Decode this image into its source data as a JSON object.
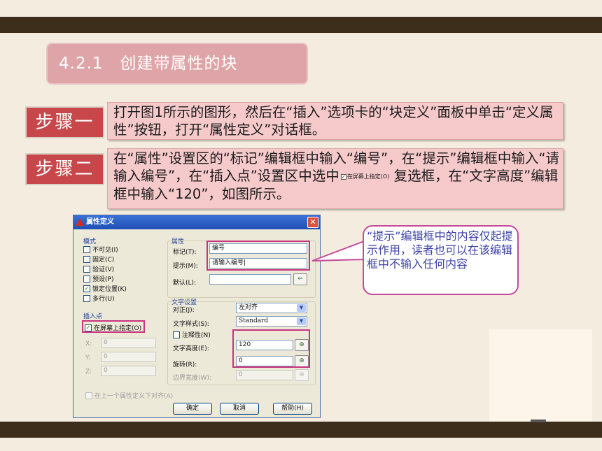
{
  "section_title": "4.2.1　创建带属性的块",
  "steps": [
    {
      "tag": "步骤一",
      "text": "打开图1所示的图形，然后在“插入”选项卡的“块定义”面板中单击“定义属性”按钮，打开“属性定义”对话框。"
    },
    {
      "tag": "步骤二",
      "text_before": "在“属性”设置区的“标记”编辑框中输入“编号”，在“提示”编辑框中输入“请输入编号”，在“插入点”设置区中选中",
      "inline_checkbox": "在屏幕上指定(O)",
      "text_after": "复选框，在“文字高度”编辑框中输入“120”，如图所示。"
    }
  ],
  "dialog": {
    "title": "属性定义",
    "close": "✕",
    "mode": {
      "label": "模式",
      "items": [
        {
          "label": "不可见(I)",
          "checked": false
        },
        {
          "label": "固定(C)",
          "checked": false
        },
        {
          "label": "验证(V)",
          "checked": false
        },
        {
          "label": "预设(P)",
          "checked": false
        },
        {
          "label": "锁定位置(K)",
          "checked": true
        },
        {
          "label": "多行(U)",
          "checked": false
        }
      ]
    },
    "insert_point": {
      "label": "插入点",
      "on_screen": "在屏幕上指定(O)",
      "x_label": "X:",
      "x_value": "0",
      "y_label": "Y:",
      "y_value": "0",
      "z_label": "Z:",
      "z_value": "0"
    },
    "attribute": {
      "label": "属性",
      "tag_label": "标记(T):",
      "tag_value": "编号",
      "prompt_label": "提示(M):",
      "prompt_value": "请输入编号|",
      "default_label": "默认(L):",
      "default_value": ""
    },
    "text_settings": {
      "label": "文字设置",
      "justify_label": "对正(J):",
      "justify_value": "左对齐",
      "style_label": "文字样式(S):",
      "style_value": "Standard",
      "annotative_label": "注释性(N)",
      "height_label": "文字高度(E):",
      "height_value": "120",
      "rotation_label": "旋转(R):",
      "rotation_value": "0",
      "boundary_label": "边界宽度(W):",
      "boundary_value": "0"
    },
    "align_below": "在上一个属性定义下对齐(A)",
    "buttons": {
      "ok": "确定",
      "cancel": "取消",
      "help": "帮助(H)"
    }
  },
  "callout": "“提示”编辑框中的内容仅起提示作用，读者也可以在该编辑框中不输入任何内容"
}
